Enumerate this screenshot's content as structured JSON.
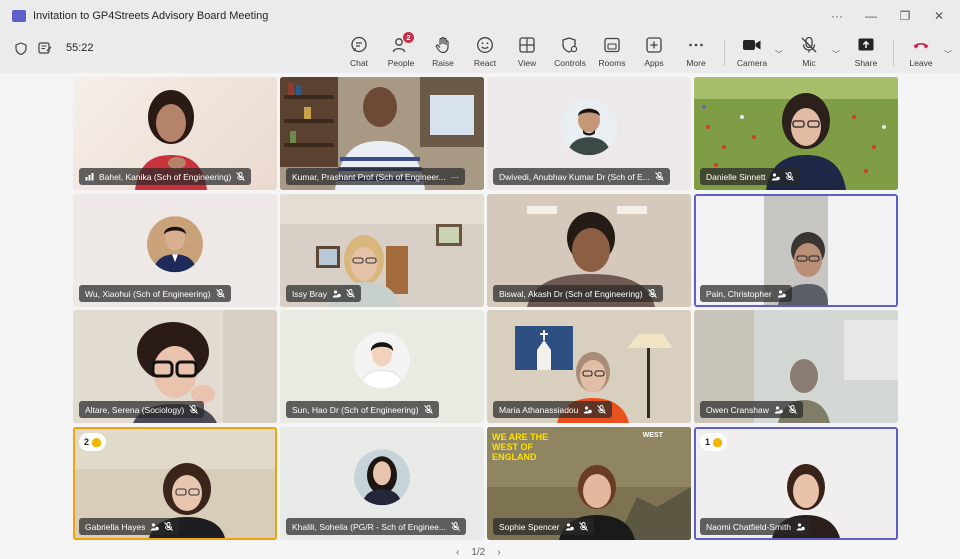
{
  "window": {
    "title": "Invitation to GP4Streets Advisory Board Meeting",
    "more": "···",
    "minimize": "—",
    "restore": "❐",
    "close": "✕"
  },
  "toolbar": {
    "timer": "55:22",
    "buttons": {
      "chat": "Chat",
      "people": "People",
      "people_badge": "2",
      "raise": "Raise",
      "react": "React",
      "view": "View",
      "controls": "Controls",
      "rooms": "Rooms",
      "apps": "Apps",
      "more": "More",
      "camera": "Camera",
      "mic": "Mic",
      "share": "Share",
      "leave": "Leave"
    },
    "leave_color": "#c4314b"
  },
  "participants": [
    {
      "name": "Bahel, Kanika (Sch of Engineering)"
    },
    {
      "name": "Kumar, Prashant Prof (Sch of Engineer...",
      "extra": "···"
    },
    {
      "name": "Dwivedi, Anubhav Kumar Dr (Sch of E..."
    },
    {
      "name": "Danielle Sinnett"
    },
    {
      "name": "Wu, Xiaohui (Sch of Engineering)"
    },
    {
      "name": "Issy Bray"
    },
    {
      "name": "Biswal, Akash Dr (Sch of Engineering)"
    },
    {
      "name": "Pain, Christopher"
    },
    {
      "name": "Altare, Serena (Sociology)"
    },
    {
      "name": "Sun, Hao Dr (Sch of Engineering)"
    },
    {
      "name": "Maria Athanassiadou"
    },
    {
      "name": "Owen Cranshaw"
    },
    {
      "name": "Gabriella Hayes",
      "hand": "2"
    },
    {
      "name": "Khalili, Soheila (PG/R - Sch of Enginee..."
    },
    {
      "name": "Sophie Spencer",
      "banner": "WE ARE THE WEST OF ENGLAND",
      "logo": "WEST"
    },
    {
      "name": "Naomi Chatfield-Smith",
      "hand": "1"
    }
  ],
  "pager": {
    "prev": "‹",
    "page": "1/2",
    "next": "›"
  }
}
